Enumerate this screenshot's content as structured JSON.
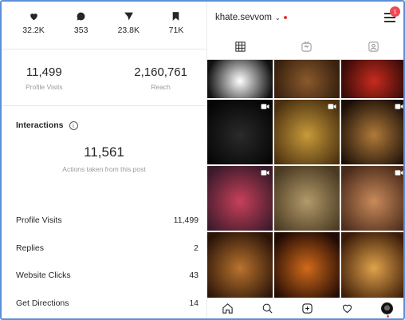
{
  "insights": {
    "stats": [
      {
        "icon": "heart-icon",
        "value": "32.2K"
      },
      {
        "icon": "comment-icon",
        "value": "353"
      },
      {
        "icon": "send-icon",
        "value": "23.8K"
      },
      {
        "icon": "bookmark-icon",
        "value": "71K"
      }
    ],
    "profile_visits": {
      "value": "11,499",
      "label": "Profile Visits"
    },
    "reach": {
      "value": "2,160,761",
      "label": "Reach"
    },
    "interactions": {
      "title": "Interactions",
      "info_glyph": "i",
      "actions_value": "11,561",
      "actions_label": "Actions taken from this post",
      "metrics": [
        {
          "label": "Profile Visits",
          "value": "11,499"
        },
        {
          "label": "Replies",
          "value": "2"
        },
        {
          "label": "Website Clicks",
          "value": "43"
        },
        {
          "label": "Get Directions",
          "value": "14"
        }
      ]
    }
  },
  "profile": {
    "username": "khate.sevvom",
    "chevron": "⌄",
    "notification_count": "1",
    "tabs": [
      {
        "name": "tab-grid",
        "icon": "grid-icon"
      },
      {
        "name": "tab-igtv",
        "icon": "igtv-icon"
      },
      {
        "name": "tab-tagged",
        "icon": "tagged-icon"
      }
    ],
    "grid_posts": [
      {
        "col": 0,
        "row": 0,
        "colors": [
          "#ffffff",
          "#111111"
        ],
        "video": false,
        "title": ""
      },
      {
        "col": 1,
        "row": 0,
        "colors": [
          "#8a5a2c",
          "#3a2210"
        ],
        "video": false,
        "title": ""
      },
      {
        "col": 2,
        "row": 0,
        "colors": [
          "#c82b1e",
          "#3a0c08"
        ],
        "video": false,
        "title": ""
      },
      {
        "col": 0,
        "row": 1,
        "colors": [
          "#2a2a2a",
          "#050505"
        ],
        "video": true,
        "title": ""
      },
      {
        "col": 1,
        "row": 1,
        "colors": [
          "#c89a3a",
          "#4a3010"
        ],
        "video": true,
        "title": ""
      },
      {
        "col": 2,
        "row": 1,
        "colors": [
          "#b07a3a",
          "#1a0e06"
        ],
        "video": true,
        "title": ""
      },
      {
        "col": 0,
        "row": 2,
        "colors": [
          "#c8405a",
          "#3a1a2a"
        ],
        "video": true,
        "title": ""
      },
      {
        "col": 1,
        "row": 2,
        "colors": [
          "#b39a6a",
          "#4a3a22"
        ],
        "video": false,
        "title": ""
      },
      {
        "col": 2,
        "row": 2,
        "colors": [
          "#c98a5a",
          "#4a2a1a"
        ],
        "video": true,
        "title": ""
      },
      {
        "col": 0,
        "row": 3,
        "colors": [
          "#b9732e",
          "#2a1408"
        ],
        "video": false,
        "title": ""
      },
      {
        "col": 1,
        "row": 3,
        "colors": [
          "#d16a1a",
          "#200a04"
        ],
        "video": false,
        "title": ""
      },
      {
        "col": 2,
        "row": 3,
        "colors": [
          "#e0a24a",
          "#3a1a08"
        ],
        "video": false,
        "title": ""
      }
    ],
    "bottom_nav": [
      {
        "name": "nav-home",
        "icon": "home-icon"
      },
      {
        "name": "nav-search",
        "icon": "search-icon"
      },
      {
        "name": "nav-add",
        "icon": "add-icon"
      },
      {
        "name": "nav-activity",
        "icon": "heart-outline-icon"
      },
      {
        "name": "nav-profile",
        "icon": "avatar-icon"
      }
    ]
  }
}
